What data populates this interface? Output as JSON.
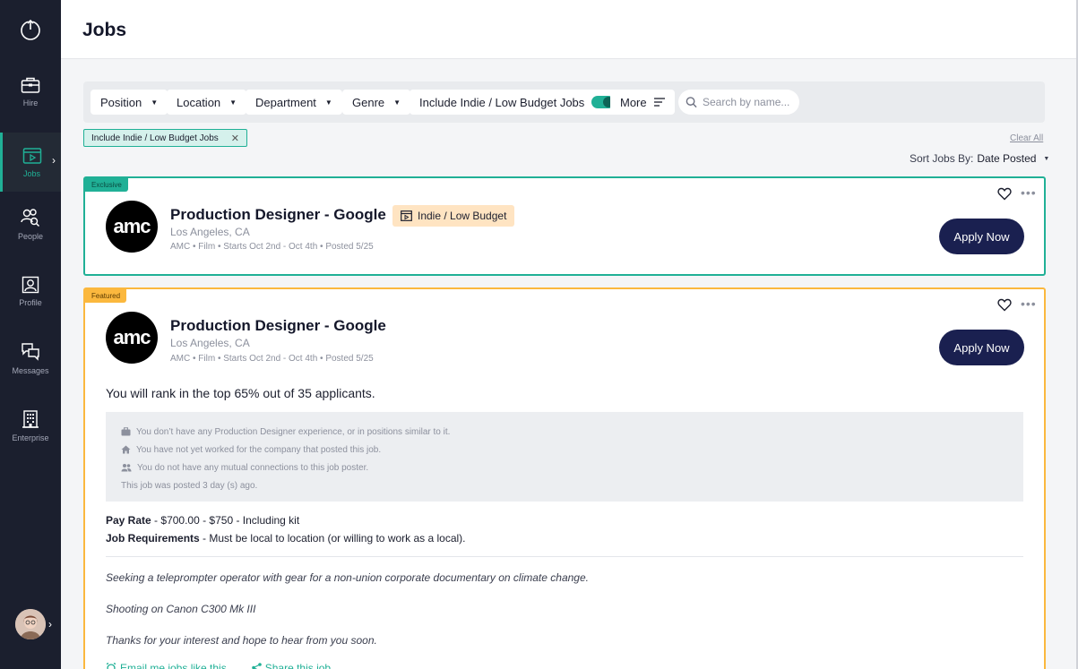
{
  "header": {
    "title": "Jobs"
  },
  "sidebar": {
    "items": [
      {
        "label": "Hire",
        "icon": "briefcase-icon"
      },
      {
        "label": "Jobs",
        "icon": "film-icon",
        "active": true
      },
      {
        "label": "People",
        "icon": "people-search-icon"
      },
      {
        "label": "Profile",
        "icon": "profile-icon"
      },
      {
        "label": "Messages",
        "icon": "messages-icon"
      },
      {
        "label": "Enterprise",
        "icon": "building-icon"
      }
    ]
  },
  "filters": {
    "position": "Position",
    "location": "Location",
    "department": "Department",
    "genre": "Genre",
    "indie_toggle": "Include Indie / Low Budget Jobs",
    "more": "More",
    "search_placeholder": "Search by name..."
  },
  "active_chip": "Include Indie / Low Budget Jobs",
  "clear_all": "Clear All",
  "sort": {
    "label": "Sort Jobs By:",
    "value": "Date Posted"
  },
  "jobs": [
    {
      "tag": "Exclusive",
      "logo": "amc",
      "title": "Production Designer - Google",
      "badge": "Indie / Low Budget",
      "location": "Los Angeles, CA",
      "meta": "AMC • Film • Starts Oct 2nd - Oct 4th • Posted 5/25",
      "apply": "Apply Now"
    },
    {
      "tag": "Featured",
      "logo": "amc",
      "title": "Production Designer - Google",
      "location": "Los Angeles, CA",
      "meta": "AMC • Film • Starts Oct 2nd - Oct 4th • Posted 5/25",
      "apply": "Apply Now",
      "rank": "You will rank in the top 65% out of 35 applicants.",
      "insights": [
        "You don’t have any Production Designer experience, or in positions similar to it.",
        "You have not yet worked for the company that posted this job.",
        "You do not have any mutual connections to this job poster.",
        "This job was posted 3 day (s) ago."
      ],
      "pay_label": "Pay Rate",
      "pay_value": "$700.00 - $750 - Including kit",
      "req_label": "Job Requirements",
      "req_value": "Must be local to location (or willing to work as a local).",
      "description": [
        "Seeking a teleprompter operator with gear for a non-union corporate documentary on climate change.",
        "Shooting on Canon C300 Mk III",
        "Thanks for your interest and hope to hear from you soon."
      ],
      "email_link": "Email me jobs like this",
      "share_link": "Share this job"
    }
  ],
  "colors": {
    "accent": "#20b096",
    "featured": "#fbb83e",
    "sidebar": "#1b1f2e",
    "apply": "#1a2050"
  }
}
